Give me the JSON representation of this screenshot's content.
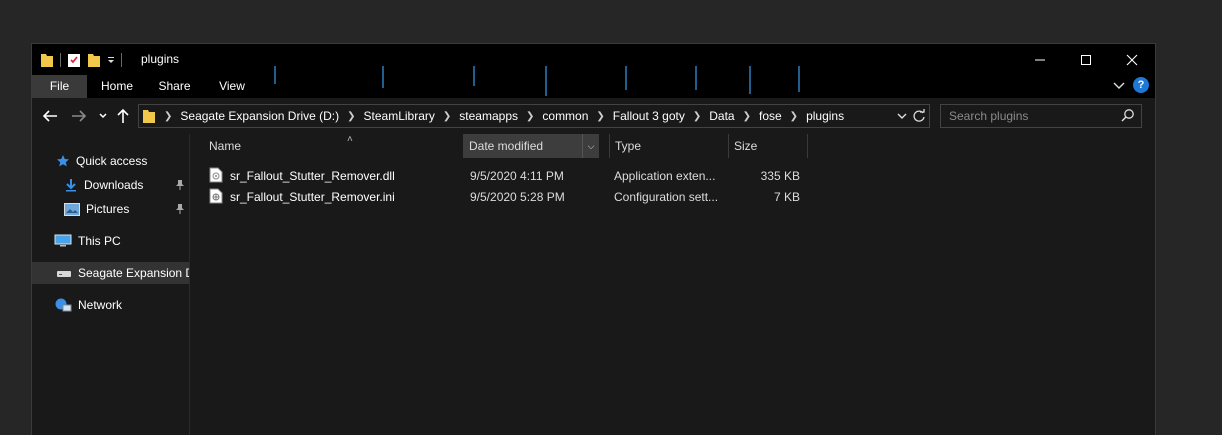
{
  "window": {
    "title": "plugins",
    "controls": {
      "minimize": "minimize",
      "maximize": "maximize",
      "close": "close"
    }
  },
  "ribbon": {
    "tabs": [
      "File",
      "Home",
      "Share",
      "View"
    ],
    "help": "?"
  },
  "address_bar": {
    "crumbs": [
      "Seagate Expansion Drive (D:)",
      "SteamLibrary",
      "steamapps",
      "common",
      "Fallout 3 goty",
      "Data",
      "fose",
      "plugins"
    ]
  },
  "search": {
    "placeholder": "Search plugins"
  },
  "nav_pane": {
    "items": [
      {
        "label": "Quick access",
        "icon": "star-icon"
      },
      {
        "label": "Downloads",
        "icon": "download-icon",
        "pinned": true
      },
      {
        "label": "Pictures",
        "icon": "pictures-icon",
        "pinned": true
      },
      {
        "label": "This PC",
        "icon": "computer-icon"
      },
      {
        "label": "Seagate Expansion Dri",
        "icon": "drive-icon",
        "selected": true
      },
      {
        "label": "Network",
        "icon": "network-icon"
      }
    ]
  },
  "columns": {
    "name": "Name",
    "date": "Date modified",
    "type": "Type",
    "size": "Size"
  },
  "files": [
    {
      "name": "sr_Fallout_Stutter_Remover.dll",
      "date": "9/5/2020 4:11 PM",
      "type": "Application exten...",
      "size": "335 KB",
      "icon": "dll-file-icon"
    },
    {
      "name": "sr_Fallout_Stutter_Remover.ini",
      "date": "9/5/2020 5:28 PM",
      "type": "Configuration sett...",
      "size": "7 KB",
      "icon": "ini-file-icon"
    }
  ],
  "colors": {
    "background": "#191919",
    "titlebar": "#000000",
    "accent": "#1e78d6",
    "folder": "#f2c84b"
  }
}
